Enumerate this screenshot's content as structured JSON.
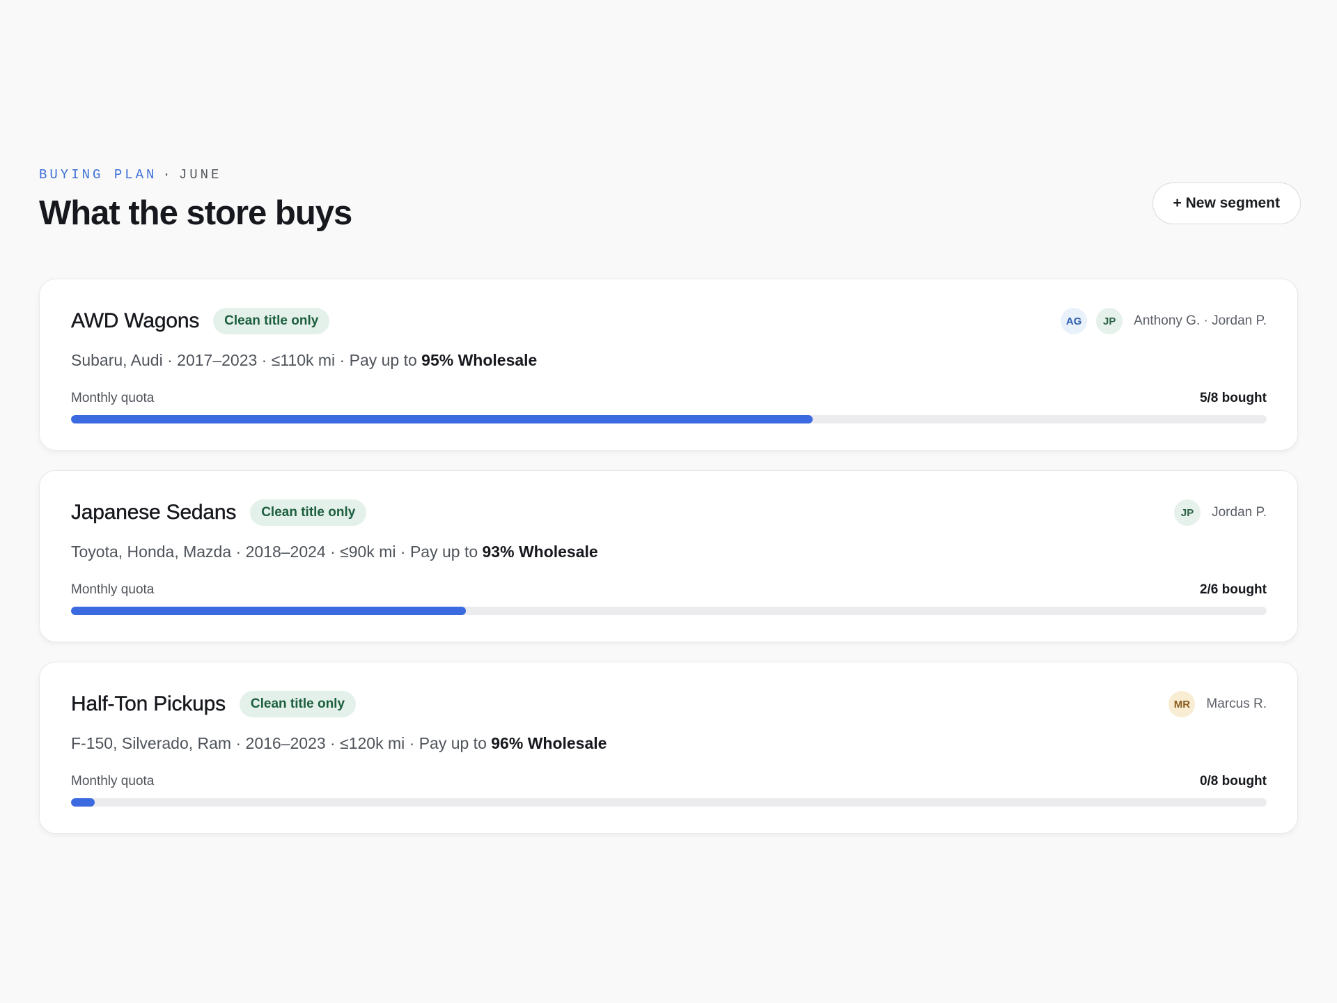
{
  "header": {
    "eyebrow_accent": "BUYING PLAN",
    "eyebrow_separator": "·",
    "eyebrow_month": "JUNE",
    "title": "What the store buys",
    "new_button_label": "+ New segment"
  },
  "segments": [
    {
      "name": "AWD Wagons",
      "badge": "Clean title only",
      "avatars": [
        {
          "initials": "AG",
          "color": "#e9f1fb"
        },
        {
          "initials": "JP",
          "color": "#e5f1ea"
        }
      ],
      "buyers": "Anthony G. · Jordan P.",
      "criteria": "Subaru, Audi · 2017–2023 · ≤110k mi · Pay up to ",
      "max_pay": "95% Wholesale",
      "quota_label": "Monthly quota",
      "quota_text": "5/8 bought",
      "progress": 0.62
    },
    {
      "name": "Japanese Sedans",
      "badge": "Clean title only",
      "avatars": [
        {
          "initials": "JP",
          "color": "#e5f1ea"
        }
      ],
      "buyers": "Jordan P.",
      "criteria": "Toyota, Honda, Mazda · 2018–2024 · ≤90k mi · Pay up to ",
      "max_pay": "93% Wholesale",
      "quota_label": "Monthly quota",
      "quota_text": "2/6 bought",
      "progress": 0.33
    },
    {
      "name": "Half-Ton Pickups",
      "badge": "Clean title only",
      "avatars": [
        {
          "initials": "MR",
          "color": "#f8ecd2"
        }
      ],
      "buyers": "Marcus R.",
      "criteria": "F-150, Silverado, Ram · 2016–2023 · ≤120k mi · Pay up to ",
      "max_pay": "96% Wholesale",
      "quota_label": "Monthly quota",
      "quota_text": "0/8 bought",
      "progress": 0.02
    }
  ],
  "colors": {
    "accent": "#3b69df",
    "badge_bg": "#e4f1ea",
    "badge_text": "#1d5e3e"
  }
}
